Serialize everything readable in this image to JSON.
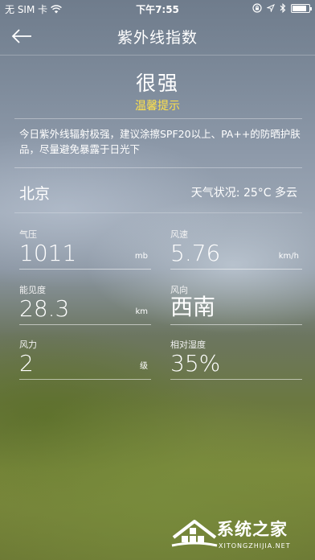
{
  "status_bar": {
    "carrier": "无 SIM 卡",
    "time": "下午7:55"
  },
  "nav": {
    "title": "紫外线指数"
  },
  "uv": {
    "level": "很强",
    "tip_label": "温馨提示",
    "advice": "今日紫外线辐射极强，建议涂擦SPF20以上、PA++的防晒护肤品，尽量避免暴露于日光下"
  },
  "location": {
    "city": "北京",
    "weather": "天气状况: 25°C 多云"
  },
  "metrics": {
    "pressure": {
      "label": "气压",
      "value": "1011",
      "unit": "mb"
    },
    "wind_speed": {
      "label": "风速",
      "value": "5.76",
      "unit": "km/h"
    },
    "visibility": {
      "label": "能见度",
      "value": "28.3",
      "unit": "km"
    },
    "wind_direction": {
      "label": "风向",
      "value": "西南",
      "unit": ""
    },
    "wind_force": {
      "label": "风力",
      "value": "2",
      "unit": "级"
    },
    "humidity": {
      "label": "相对湿度",
      "value": "35%",
      "unit": ""
    }
  },
  "watermark": {
    "text": "系统之家",
    "sub": "XITONGZHIJIA.NET"
  },
  "icons": {
    "back": "arrow-left-icon",
    "wifi": "wifi-icon",
    "lock": "orientation-lock-icon",
    "location": "location-arrow-icon",
    "bluetooth": "bluetooth-icon",
    "battery": "battery-icon"
  },
  "colors": {
    "tip": "#ffe24a",
    "battery_fill": 0.85
  }
}
